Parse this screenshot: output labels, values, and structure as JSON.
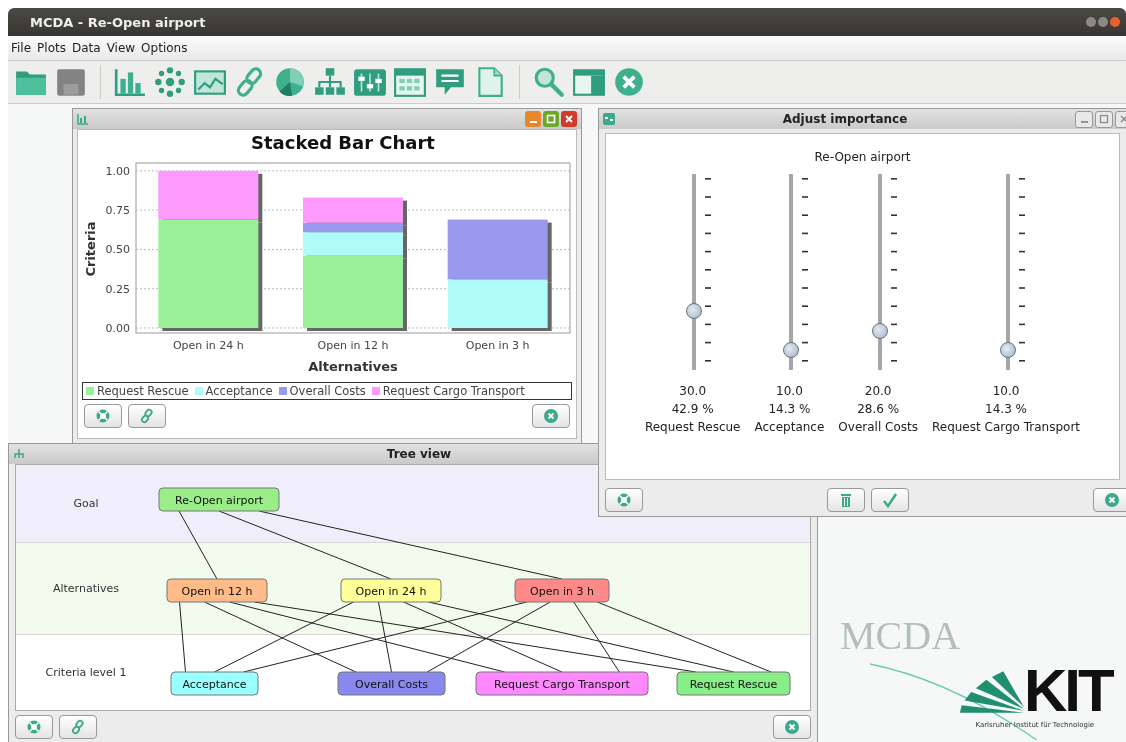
{
  "window": {
    "title": "MCDA - Re-Open airport"
  },
  "menu": [
    "File",
    "Plots",
    "Data",
    "View",
    "Options"
  ],
  "toolbar": [
    {
      "kind": "folder",
      "disabled": false
    },
    {
      "kind": "save",
      "disabled": true
    },
    {
      "kind": "bars",
      "disabled": false
    },
    {
      "kind": "scatter",
      "disabled": false
    },
    {
      "kind": "linechart",
      "disabled": false
    },
    {
      "kind": "link",
      "disabled": false
    },
    {
      "kind": "pie",
      "disabled": false
    },
    {
      "kind": "hierarchy",
      "disabled": false
    },
    {
      "kind": "sliders",
      "disabled": false
    },
    {
      "kind": "calendar",
      "disabled": false
    },
    {
      "kind": "speech",
      "disabled": false
    },
    {
      "kind": "document",
      "disabled": false
    },
    {
      "kind": "search",
      "disabled": false
    },
    {
      "kind": "layout",
      "disabled": false
    },
    {
      "kind": "close",
      "disabled": false
    }
  ],
  "chart_window": {
    "chart_data": {
      "type": "bar",
      "stacked": true,
      "grid": true,
      "title": "Stacked Bar Chart",
      "xlabel": "Alternatives",
      "ylabel": "Criteria",
      "categories": [
        "Open in 24 h",
        "Open in 12 h",
        "Open in 3 h"
      ],
      "ylim": [
        0,
        1.05
      ],
      "yticks": [
        {
          "value": 0,
          "label": "0.00"
        },
        {
          "value": 0.25,
          "label": "0.25"
        },
        {
          "value": 0.5,
          "label": "0.50"
        },
        {
          "value": 0.75,
          "label": "0.75"
        },
        {
          "value": 1,
          "label": "1.00"
        }
      ],
      "series": [
        {
          "name": "Request Rescue",
          "color": "#99f099",
          "values": [
            0.69,
            0.46,
            0
          ]
        },
        {
          "name": "Acceptance",
          "color": "#b0fafa",
          "values": [
            0,
            0.15,
            0.31
          ]
        },
        {
          "name": "Overall Costs",
          "color": "#9999ee",
          "values": [
            0,
            0.06,
            0.38
          ]
        },
        {
          "name": "Request Cargo Transport",
          "color": "#ff99ff",
          "values": [
            0.31,
            0.16,
            0
          ]
        }
      ]
    }
  },
  "importance_window": {
    "title": "Adjust importance",
    "goal": "Re-Open airport",
    "sliders": [
      {
        "label": "Request Rescue",
        "value": "30.0",
        "percent": "42.9 %",
        "level": 0.3
      },
      {
        "label": "Acceptance",
        "value": "10.0",
        "percent": "14.3 %",
        "level": 0.1
      },
      {
        "label": "Overall Costs",
        "value": "20.0",
        "percent": "28.6 %",
        "level": 0.2
      },
      {
        "label": "Request Cargo Transport",
        "value": "10.0",
        "percent": "14.3 %",
        "level": 0.1
      }
    ]
  },
  "tree_window": {
    "title": "Tree view",
    "levels": [
      {
        "label": "Goal",
        "nodes": [
          {
            "label": "Re-Open airport",
            "color": "#99ee88"
          }
        ]
      },
      {
        "label": "Alternatives",
        "nodes": [
          {
            "label": "Open in 12 h",
            "color": "#ffbb88"
          },
          {
            "label": "Open in 24 h",
            "color": "#ffff99"
          },
          {
            "label": "Open in 3 h",
            "color": "#ff8888"
          }
        ]
      },
      {
        "label": "Criteria level 1",
        "nodes": [
          {
            "label": "Acceptance",
            "color": "#99ffff"
          },
          {
            "label": "Overall Costs",
            "color": "#8888ee"
          },
          {
            "label": "Request Cargo Transport",
            "color": "#ff88ff"
          },
          {
            "label": "Request Rescue",
            "color": "#88ee88"
          }
        ]
      }
    ]
  },
  "background": {
    "watermark": "MCDA",
    "logo": "KIT",
    "logo_tagline": "Karlsruher Institut für Technologie"
  }
}
